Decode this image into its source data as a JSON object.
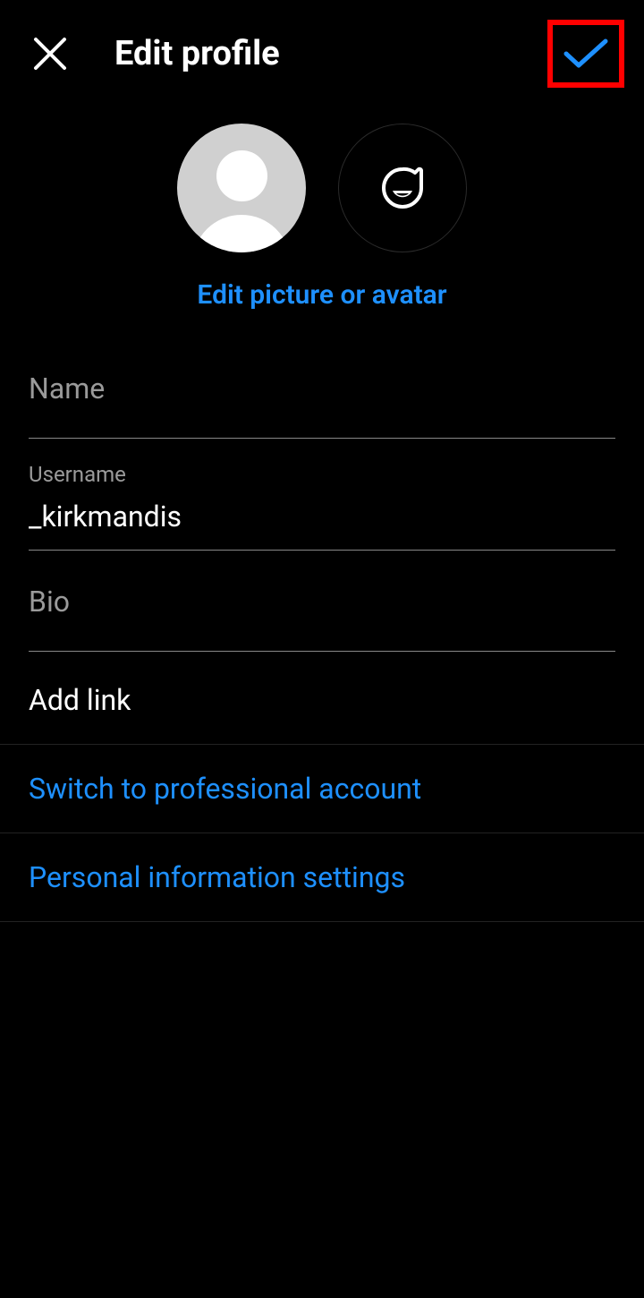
{
  "header": {
    "title": "Edit profile"
  },
  "avatar": {
    "edit_link": "Edit picture or avatar"
  },
  "fields": {
    "name_label": "Name",
    "name_value": "",
    "username_label": "Username",
    "username_value": "_kirkmandis",
    "bio_label": "Bio",
    "bio_value": ""
  },
  "links": {
    "add_link": "Add link",
    "switch_professional": "Switch to professional account",
    "personal_info": "Personal information settings"
  }
}
